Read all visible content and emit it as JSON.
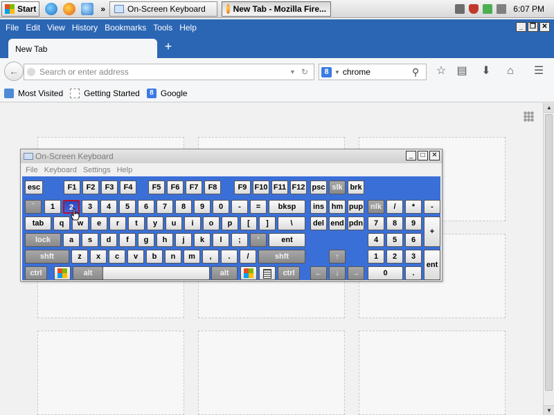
{
  "taskbar": {
    "start_label": "Start",
    "overflow": "»",
    "tasks": [
      {
        "label": "On-Screen Keyboard",
        "active": false
      },
      {
        "label": "New Tab - Mozilla Fire...",
        "active": true
      }
    ],
    "clock": "6:07 PM",
    "quick_launch_icons": [
      "internet-explorer-icon",
      "firefox-icon",
      "app-icon"
    ],
    "tray_icons": [
      "keyboard-icon",
      "shield-icon",
      "network-icon",
      "volume-icon"
    ]
  },
  "firefox": {
    "menu": [
      "File",
      "Edit",
      "View",
      "History",
      "Bookmarks",
      "Tools",
      "Help"
    ],
    "window_controls": [
      "_",
      "❐",
      "✕"
    ],
    "tab_label": "New Tab",
    "new_tab_glyph": "+",
    "url_placeholder": "Search or enter address",
    "search_engine_glyph": "8",
    "search_value": "chrome",
    "bookmarks": [
      {
        "label": "Most Visited",
        "icon": "most-visited-icon"
      },
      {
        "label": "Getting Started",
        "icon": "page-icon"
      },
      {
        "label": "Google",
        "icon": "google-icon"
      }
    ],
    "toolbar_icons": [
      "star-icon",
      "reading-list-icon",
      "download-icon",
      "home-icon",
      "menu-icon"
    ]
  },
  "osk": {
    "title": "On-Screen Keyboard",
    "menu": [
      "File",
      "Keyboard",
      "Settings",
      "Help"
    ],
    "controls": [
      "_",
      "□",
      "✕"
    ],
    "pressed_key": "2",
    "keys": [
      {
        "label": "esc"
      },
      {
        "label": "F1"
      },
      {
        "label": "F2"
      },
      {
        "label": "F3"
      },
      {
        "label": "F4"
      },
      {
        "label": "F5"
      },
      {
        "label": "F6"
      },
      {
        "label": "F7"
      },
      {
        "label": "F8"
      },
      {
        "label": "F9"
      },
      {
        "label": "F10"
      },
      {
        "label": "F11"
      },
      {
        "label": "F12"
      },
      {
        "label": "psc"
      },
      {
        "label": "slk"
      },
      {
        "label": "brk"
      },
      {
        "label": "`"
      },
      {
        "label": "1"
      },
      {
        "label": "2"
      },
      {
        "label": "3"
      },
      {
        "label": "4"
      },
      {
        "label": "5"
      },
      {
        "label": "6"
      },
      {
        "label": "7"
      },
      {
        "label": "8"
      },
      {
        "label": "9"
      },
      {
        "label": "0"
      },
      {
        "label": "-"
      },
      {
        "label": "="
      },
      {
        "label": "bksp"
      },
      {
        "label": "ins"
      },
      {
        "label": "hm"
      },
      {
        "label": "pup"
      },
      {
        "label": "nlk"
      },
      {
        "label": "/"
      },
      {
        "label": "*"
      },
      {
        "label": "-"
      },
      {
        "label": "tab"
      },
      {
        "label": "q"
      },
      {
        "label": "w"
      },
      {
        "label": "e"
      },
      {
        "label": "r"
      },
      {
        "label": "t"
      },
      {
        "label": "y"
      },
      {
        "label": "u"
      },
      {
        "label": "i"
      },
      {
        "label": "o"
      },
      {
        "label": "p"
      },
      {
        "label": "["
      },
      {
        "label": "]"
      },
      {
        "label": "\\"
      },
      {
        "label": "del"
      },
      {
        "label": "end"
      },
      {
        "label": "pdn"
      },
      {
        "label": "7"
      },
      {
        "label": "8"
      },
      {
        "label": "9"
      },
      {
        "label": "+"
      },
      {
        "label": "lock"
      },
      {
        "label": "a"
      },
      {
        "label": "s"
      },
      {
        "label": "d"
      },
      {
        "label": "f"
      },
      {
        "label": "g"
      },
      {
        "label": "h"
      },
      {
        "label": "j"
      },
      {
        "label": "k"
      },
      {
        "label": "l"
      },
      {
        "label": ";"
      },
      {
        "label": "'"
      },
      {
        "label": "ent"
      },
      {
        "label": "4"
      },
      {
        "label": "5"
      },
      {
        "label": "6"
      },
      {
        "label": "shft"
      },
      {
        "label": "z"
      },
      {
        "label": "x"
      },
      {
        "label": "c"
      },
      {
        "label": "v"
      },
      {
        "label": "b"
      },
      {
        "label": "n"
      },
      {
        "label": "m"
      },
      {
        "label": ","
      },
      {
        "label": "."
      },
      {
        "label": "/"
      },
      {
        "label": "shft"
      },
      {
        "label": "↑"
      },
      {
        "label": "1"
      },
      {
        "label": "2"
      },
      {
        "label": "3"
      },
      {
        "label": "ent"
      },
      {
        "label": "ctrl"
      },
      {
        "label": ""
      },
      {
        "label": "alt"
      },
      {
        "label": ""
      },
      {
        "label": "alt"
      },
      {
        "label": ""
      },
      {
        "label": ""
      },
      {
        "label": "ctrl"
      },
      {
        "label": "←"
      },
      {
        "label": "↓"
      },
      {
        "label": "→"
      },
      {
        "label": "0"
      },
      {
        "label": "."
      }
    ]
  }
}
